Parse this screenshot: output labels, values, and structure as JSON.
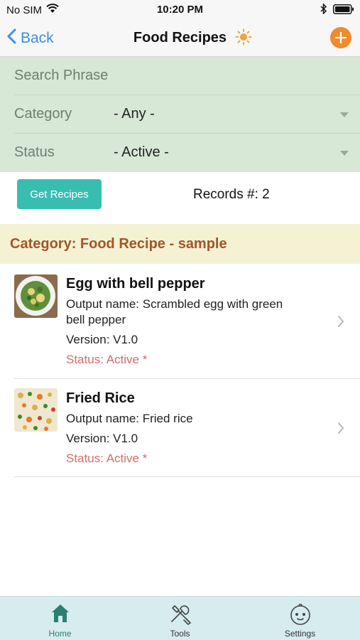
{
  "status_bar": {
    "carrier": "No SIM",
    "time": "10:20 PM"
  },
  "nav": {
    "back_label": "Back",
    "title": "Food Recipes"
  },
  "filters": {
    "search_placeholder": "Search Phrase",
    "category_label": "Category",
    "category_value": "- Any -",
    "status_label": "Status",
    "status_value": "- Active -"
  },
  "actions": {
    "get_recipes_label": "Get Recipes",
    "records_text": "Records #: 2"
  },
  "category_header": "Category: Food Recipe - sample",
  "recipes": [
    {
      "title": "Egg with bell pepper",
      "output_name_line1": "Output name: Scrambled egg with green",
      "output_name_line2": "bell pepper",
      "version": "Version: V1.0",
      "status": "Status: Active *"
    },
    {
      "title": "Fried Rice",
      "output_name_line1": "Output name: Fried rice",
      "output_name_line2": "",
      "version": "Version: V1.0",
      "status": "Status: Active *"
    }
  ],
  "tabs": [
    {
      "label": "Home",
      "icon": "home-icon",
      "active": true
    },
    {
      "label": "Tools",
      "icon": "tools-icon",
      "active": false
    },
    {
      "label": "Settings",
      "icon": "baby-face-icon",
      "active": false
    }
  ],
  "colors": {
    "accent_blue": "#3d8ee8",
    "filter_bg": "#d7e8d7",
    "button_teal": "#38bdb1",
    "category_bg": "#f5f2d3",
    "category_text": "#a0562a",
    "status_red": "#d36b6b",
    "add_orange": "#f08a2c",
    "tabbar_bg": "#d6ecee"
  }
}
